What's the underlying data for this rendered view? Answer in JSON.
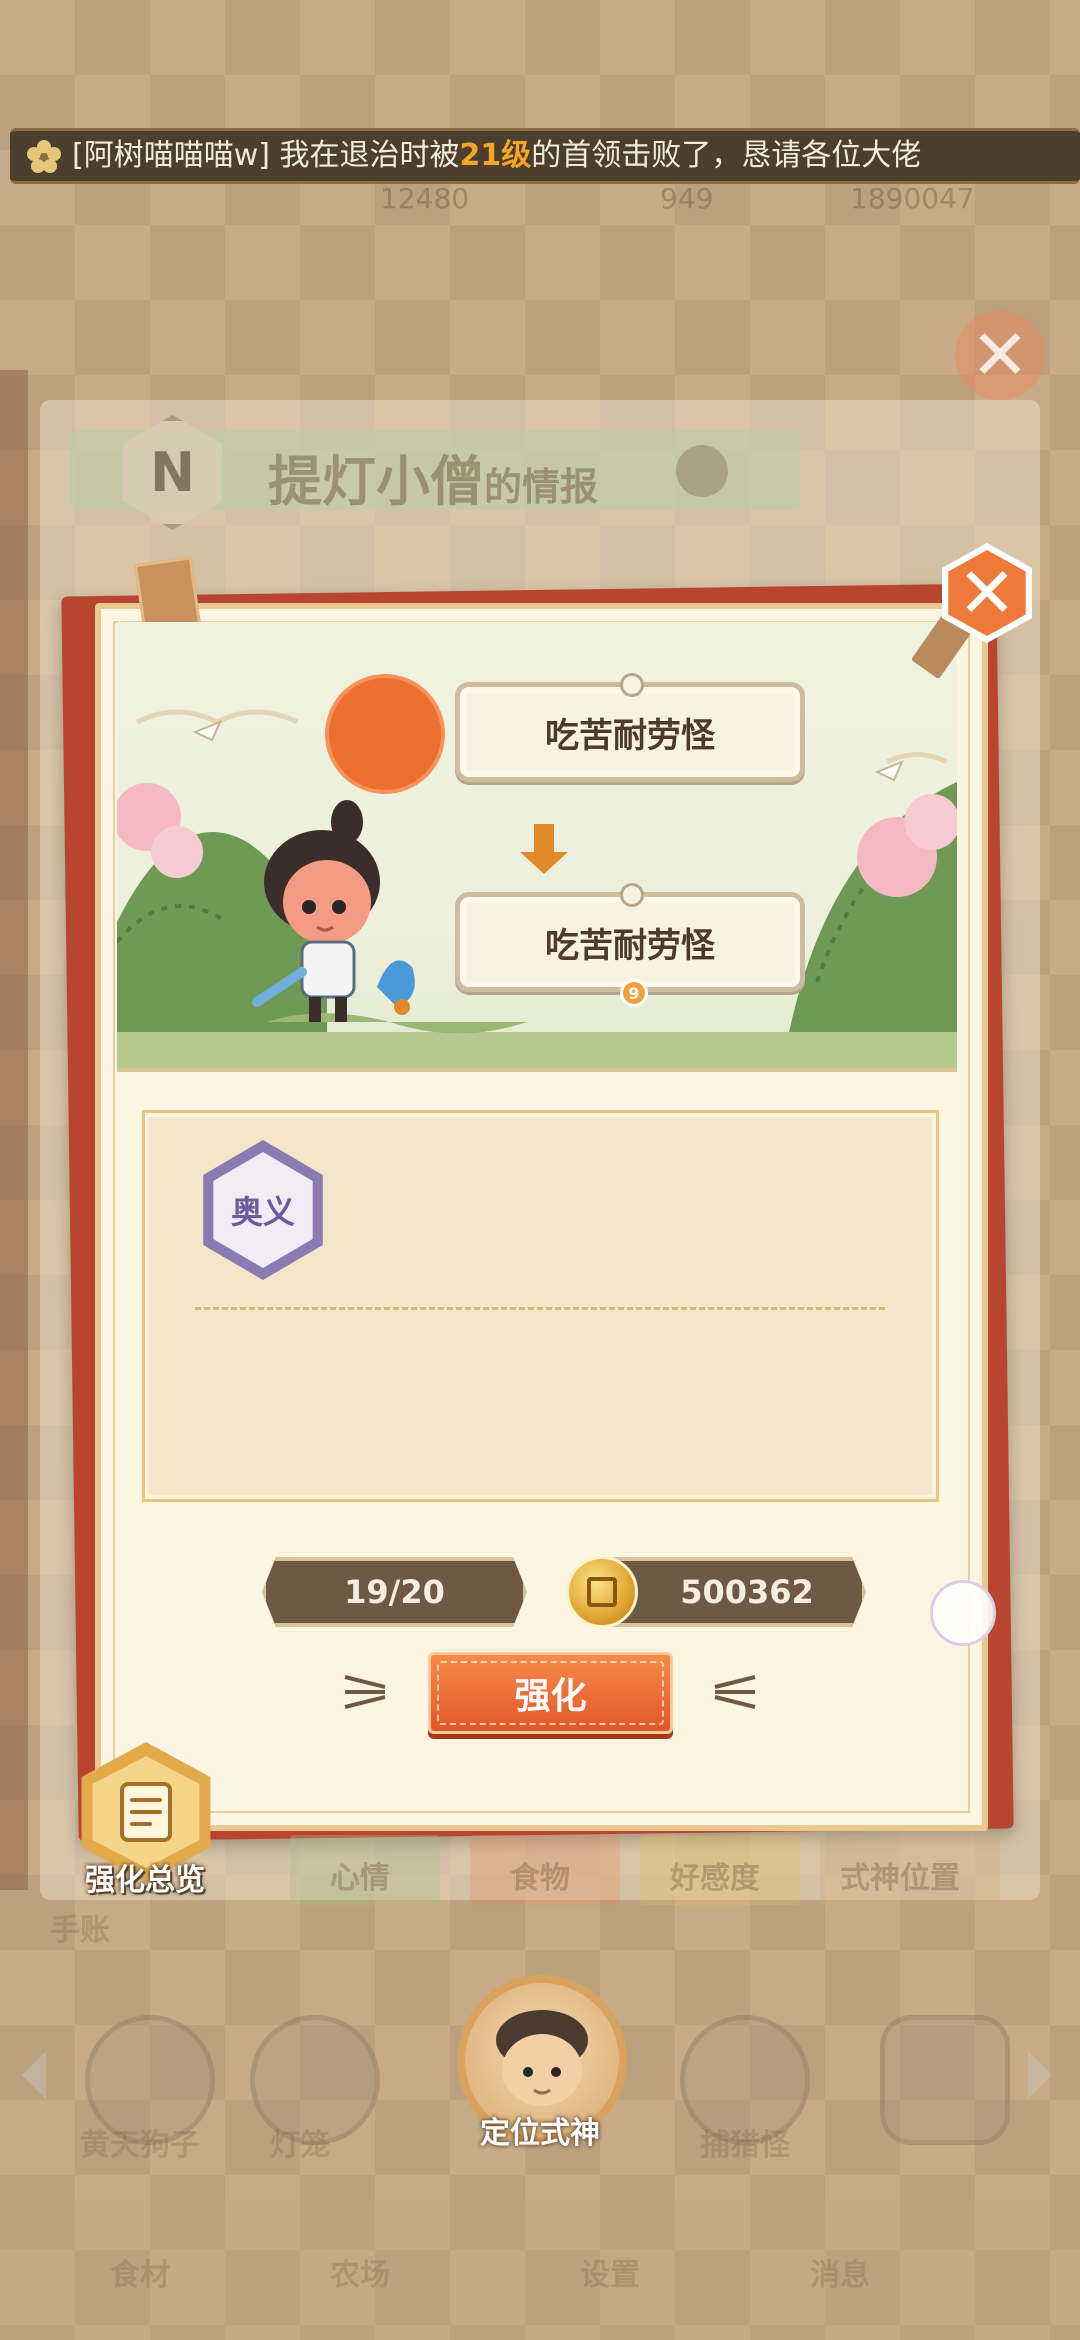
{
  "marquee": {
    "prefix": "[阿树喵喵喵w] 我在退治时被",
    "level": "21级",
    "suffix": "的首领击败了，恳请各位大佬"
  },
  "background": {
    "stat_values": [
      "12480",
      "949",
      "1890047"
    ],
    "medal_letter": "N",
    "shikigami_name": "提灯小僧",
    "title_suffix": "的情报",
    "tabs": [
      "心情",
      "食物",
      "好感度",
      "式神位置"
    ],
    "side_labels": [
      "手账"
    ],
    "bottom_names": [
      "黄天狗子",
      "灯笼",
      "捕猎怪"
    ],
    "bottom_menu": [
      "食材",
      "农场",
      "设置",
      "消息"
    ]
  },
  "card": {
    "form_before": "吃苦耐劳怪",
    "form_after": "吃苦耐劳怪",
    "level_badge": "9",
    "skill_badge": "奥义",
    "progress": "19/20",
    "coins": "500362",
    "enhance_label": "强化"
  },
  "overview_label": "强化总览",
  "locate_label": "定位式神",
  "colors": {
    "accent": "#ee7a3a",
    "card_red": "#b8452f",
    "pill_dark": "#6e5a44",
    "skill_badge": "#8c7bb2"
  },
  "icons": {
    "close": "close-icon",
    "coin": "coin-icon",
    "overview": "document-icon",
    "skill": "hexagon-badge-icon"
  }
}
